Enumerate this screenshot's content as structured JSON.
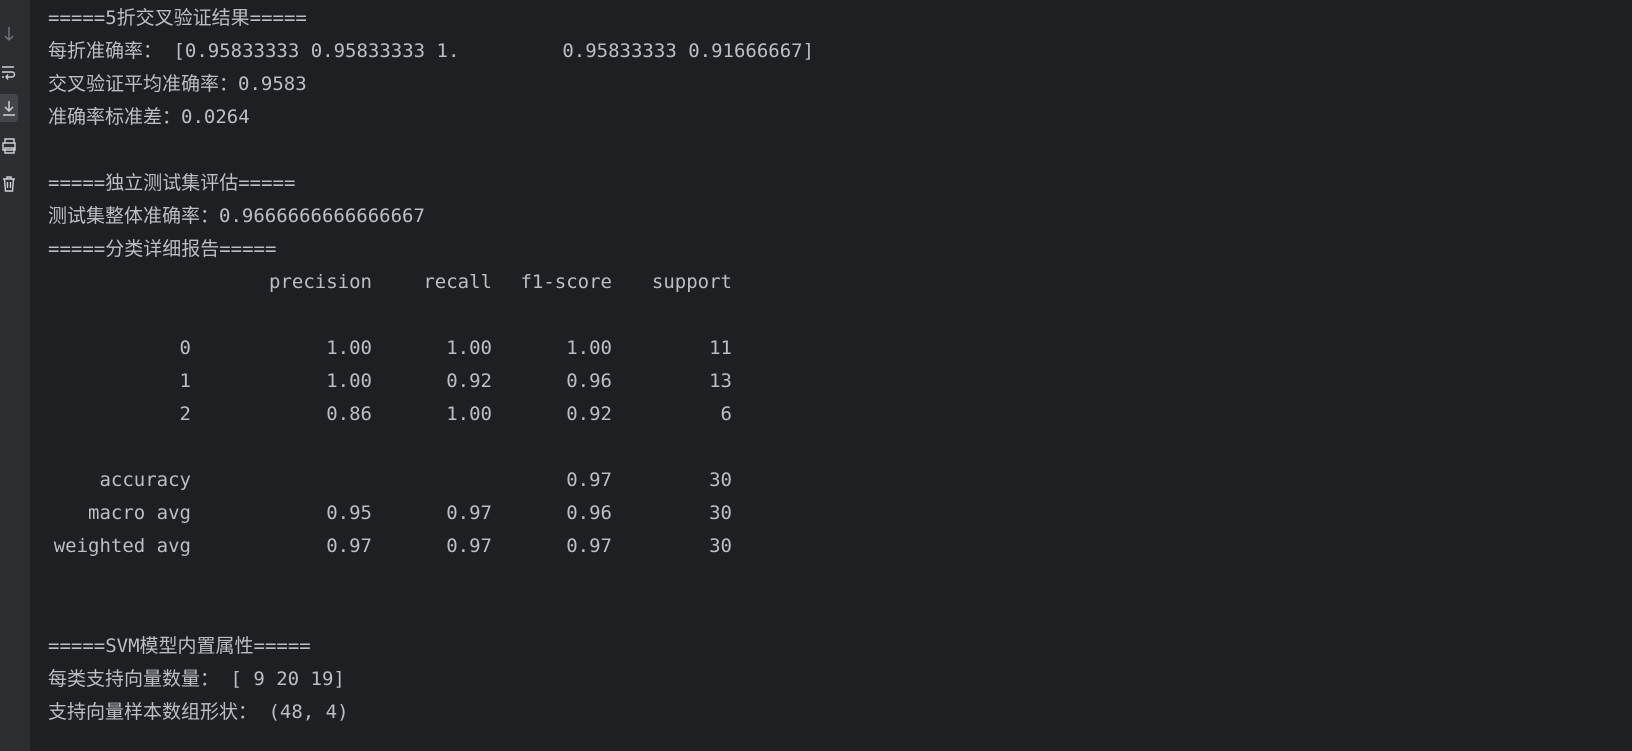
{
  "toolbar": {
    "tools": [
      {
        "name": "scroll-down-arrow",
        "icon": "arrow-down-icon"
      },
      {
        "name": "soft-wrap",
        "icon": "soft-wrap-icon"
      },
      {
        "name": "scroll-to-end",
        "icon": "scroll-to-end-icon",
        "active": true
      },
      {
        "name": "print",
        "icon": "print-icon"
      },
      {
        "name": "clear-all",
        "icon": "trash-icon"
      }
    ]
  },
  "console": {
    "cv_header": "=====5折交叉验证结果=====",
    "fold_accuracy": "每折准确率： [0.95833333 0.95833333 1.         0.95833333 0.91666667]",
    "cv_mean": "交叉验证平均准确率：0.9583",
    "cv_std": "准确率标准差：0.0264",
    "test_header": "=====独立测试集评估=====",
    "test_accuracy": "测试集整体准确率：0.9666666666666667",
    "report_header": "=====分类详细报告=====",
    "report": {
      "columns": [
        "",
        "precision",
        "recall",
        "f1-score",
        "support"
      ],
      "rows": [
        [
          "0",
          "1.00",
          "1.00",
          "1.00",
          "11"
        ],
        [
          "1",
          "1.00",
          "0.92",
          "0.96",
          "13"
        ],
        [
          "2",
          "0.86",
          "1.00",
          "0.92",
          "6"
        ],
        [
          "accuracy",
          "",
          "",
          "0.97",
          "30"
        ],
        [
          "macro avg",
          "0.95",
          "0.97",
          "0.96",
          "30"
        ],
        [
          "weighted avg",
          "0.97",
          "0.97",
          "0.97",
          "30"
        ]
      ]
    },
    "svm_header": "=====SVM模型内置属性=====",
    "support_vectors_per_class": "每类支持向量数量： [ 9 20 19]",
    "support_vectors_shape": "支持向量样本数组形状： (48, 4)"
  },
  "colors": {
    "background": "#1e1f22",
    "gutter": "#2b2d30",
    "text": "#bcbec4",
    "icon": "#ced0d6"
  }
}
